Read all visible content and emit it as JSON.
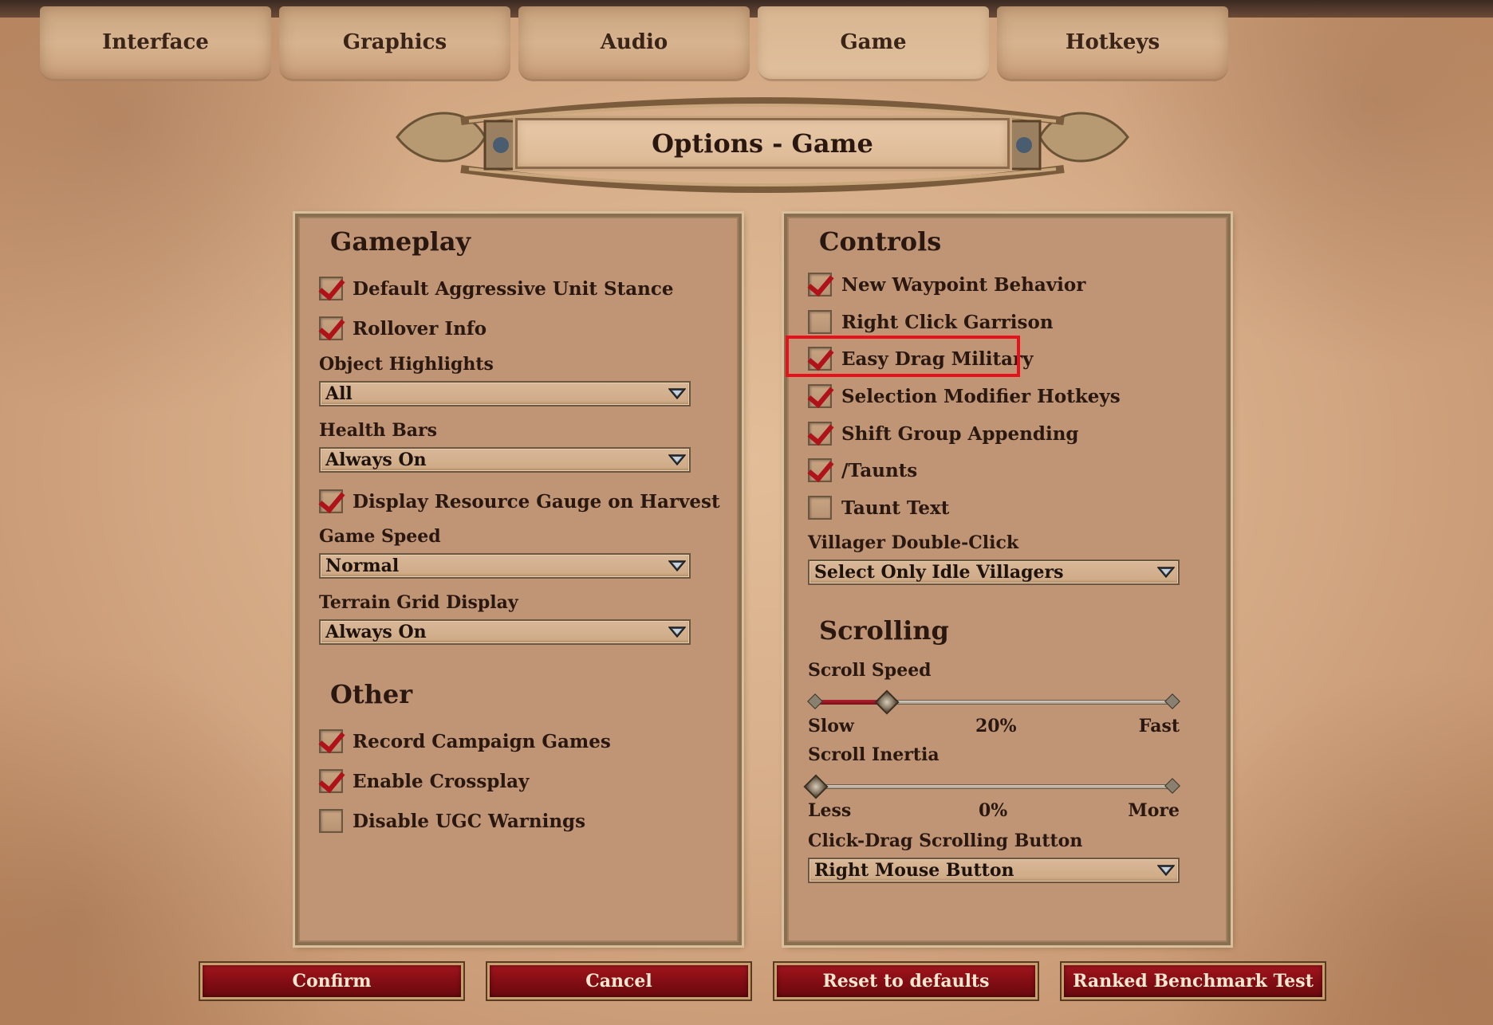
{
  "tabs": [
    "Interface",
    "Graphics",
    "Audio",
    "Game",
    "Hotkeys"
  ],
  "active_tab": "Game",
  "title": "Options - Game",
  "gameplay": {
    "heading": "Gameplay",
    "checks": [
      {
        "label": "Default Aggressive Unit Stance",
        "checked": true
      },
      {
        "label": "Rollover Info",
        "checked": true
      }
    ],
    "object_highlights": {
      "label": "Object Highlights",
      "value": "All"
    },
    "health_bars": {
      "label": "Health Bars",
      "value": "Always On"
    },
    "resource_gauge": {
      "label": "Display Resource Gauge on Harvest",
      "checked": true
    },
    "game_speed": {
      "label": "Game Speed",
      "value": "Normal"
    },
    "terrain_grid": {
      "label": "Terrain Grid Display",
      "value": "Always On"
    }
  },
  "other": {
    "heading": "Other",
    "checks": [
      {
        "label": "Record Campaign Games",
        "checked": true
      },
      {
        "label": "Enable Crossplay",
        "checked": true
      },
      {
        "label": "Disable UGC Warnings",
        "checked": false
      }
    ]
  },
  "controls": {
    "heading": "Controls",
    "checks": [
      {
        "label": "New Waypoint Behavior",
        "checked": true
      },
      {
        "label": "Right Click Garrison",
        "checked": false
      },
      {
        "label": "Easy Drag Military",
        "checked": true
      },
      {
        "label": "Selection Modifier Hotkeys",
        "checked": true
      },
      {
        "label": "Shift Group Appending",
        "checked": true
      },
      {
        "label": "/Taunts",
        "checked": true
      },
      {
        "label": "Taunt Text",
        "checked": false
      }
    ],
    "villager_double_click": {
      "label": "Villager Double-Click",
      "value": "Select Only Idle Villagers"
    }
  },
  "scrolling": {
    "heading": "Scrolling",
    "scroll_speed": {
      "label": "Scroll Speed",
      "min_label": "Slow",
      "max_label": "Fast",
      "value_label": "20%",
      "value": 0.2
    },
    "scroll_inertia": {
      "label": "Scroll Inertia",
      "min_label": "Less",
      "max_label": "More",
      "value_label": "0%",
      "value": 0.0
    },
    "click_drag": {
      "label": "Click-Drag Scrolling Button",
      "value": "Right Mouse Button"
    }
  },
  "buttons": {
    "confirm": "Confirm",
    "cancel": "Cancel",
    "reset": "Reset to defaults",
    "benchmark": "Ranked Benchmark Test"
  },
  "colors": {
    "accent_red": "#b0121a",
    "highlight": "#e8101a",
    "button_red": "#8a1016"
  }
}
